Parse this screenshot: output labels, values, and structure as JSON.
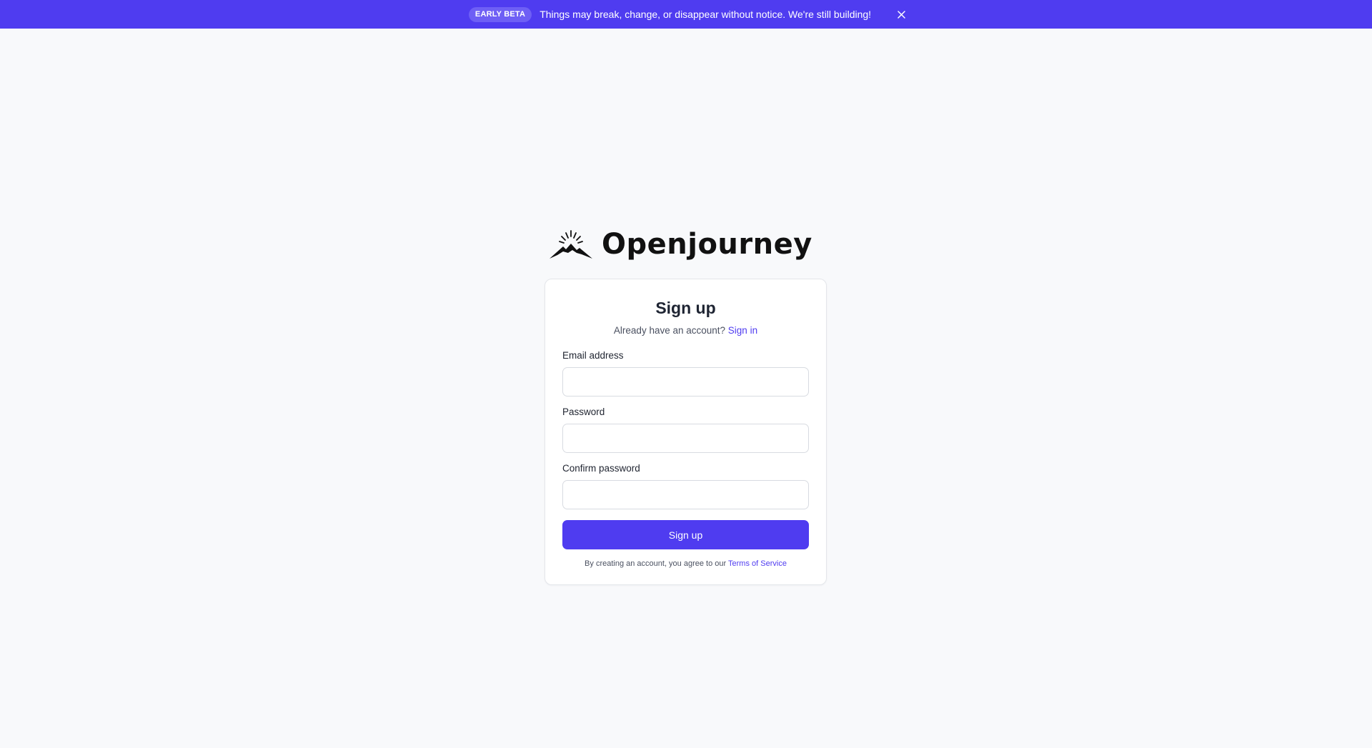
{
  "banner": {
    "badge": "EARLY BETA",
    "message": "Things may break, change, or disappear without notice. We're still building!",
    "close_icon": "close-icon",
    "background_color": "#4f3cf0"
  },
  "brand": {
    "name": "Openjourney",
    "logo_icon": "mountain-sunburst-icon"
  },
  "form": {
    "title": "Sign up",
    "signin_prompt": "Already have an account?",
    "signin_link": "Sign in",
    "email_label": "Email address",
    "email_value": "",
    "password_label": "Password",
    "password_value": "",
    "confirm_label": "Confirm password",
    "confirm_value": "",
    "submit_label": "Sign up",
    "terms_prefix": "By creating an account, you agree to our",
    "terms_link": "Terms of Service",
    "accent_color": "#4f3cf0"
  }
}
